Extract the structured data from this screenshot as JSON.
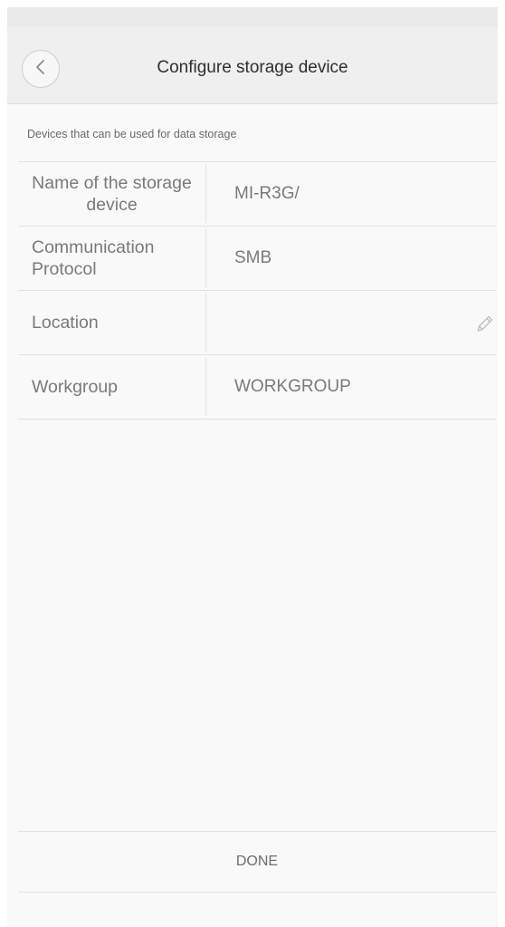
{
  "header": {
    "title": "Configure storage device",
    "back_icon": "chevron-left-icon"
  },
  "section": {
    "caption": "Devices that can be used for data storage"
  },
  "form": {
    "rows": [
      {
        "label": "Name of the storage device",
        "value": "MI-R3G/"
      },
      {
        "label": "Communication Protocol",
        "value": "SMB"
      },
      {
        "label": "Location",
        "value": "",
        "icon": "pencil-edit-icon"
      },
      {
        "label": "Workgroup",
        "value": "WORKGROUP"
      }
    ]
  },
  "footer": {
    "done_label": "DONE"
  },
  "colors": {
    "header_bg": "#efefef",
    "page_bg": "#f9f9f9",
    "divider": "#e2e2e2",
    "label_text": "#7a7a7a",
    "title_text": "#2e2e2e"
  }
}
